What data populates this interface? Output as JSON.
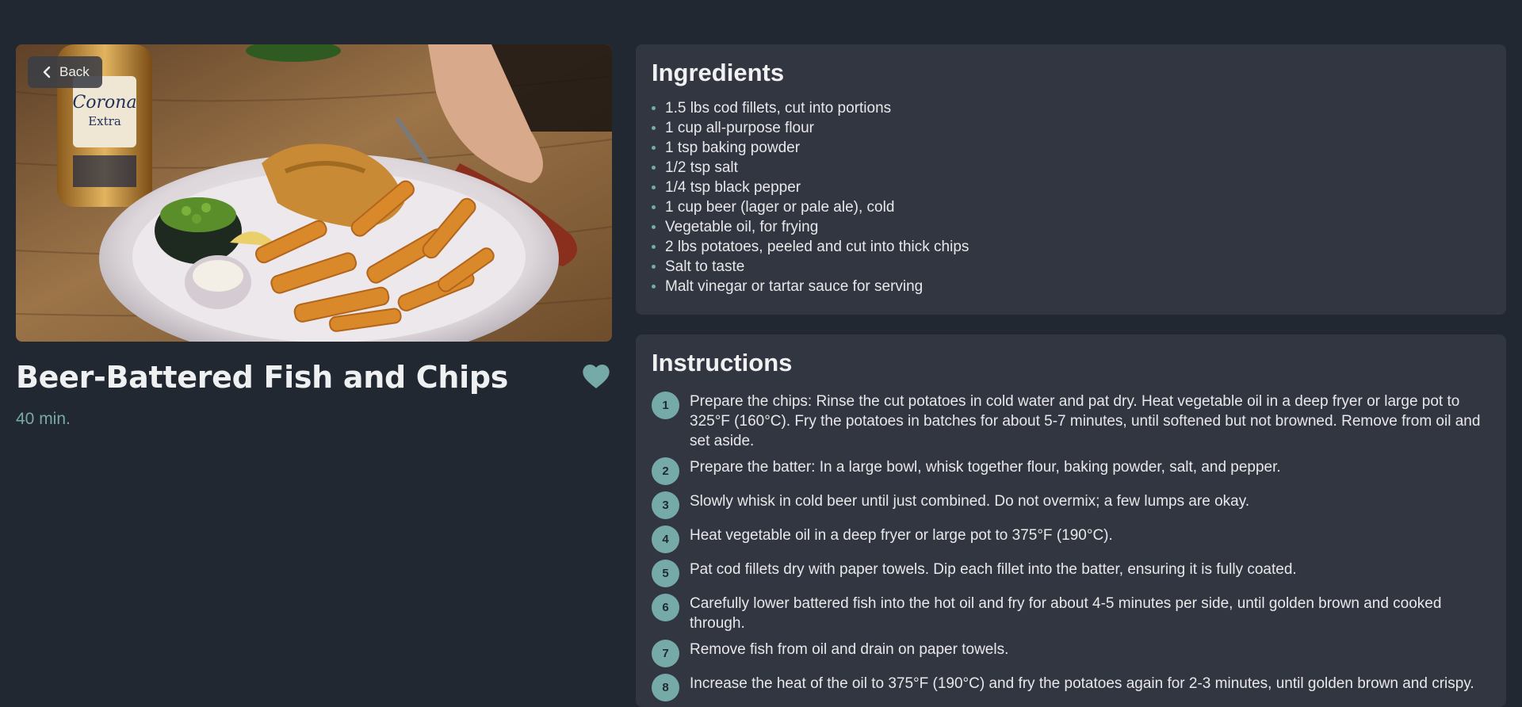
{
  "nav": {
    "back_label": "Back",
    "back_icon": "chevron-left-icon"
  },
  "recipe": {
    "title": "Beer-Battered Fish and Chips",
    "time": "40 min.",
    "favorite_icon": "heart-icon",
    "accent_color": "#76aaa9"
  },
  "ingredients": {
    "heading": "Ingredients",
    "items": [
      "1.5 lbs cod fillets, cut into portions",
      "1 cup all-purpose flour",
      "1 tsp baking powder",
      "1/2 tsp salt",
      "1/4 tsp black pepper",
      "1 cup beer (lager or pale ale), cold",
      "Vegetable oil, for frying",
      "2 lbs potatoes, peeled and cut into thick chips",
      "Salt to taste",
      "Malt vinegar or tartar sauce for serving"
    ]
  },
  "instructions": {
    "heading": "Instructions",
    "steps": [
      {
        "number": "1",
        "text": "Prepare the chips: Rinse the cut potatoes in cold water and pat dry. Heat vegetable oil in a deep fryer or large pot to 325°F (160°C). Fry the potatoes in batches for about 5-7 minutes, until softened but not browned. Remove from oil and set aside."
      },
      {
        "number": "2",
        "text": "Prepare the batter: In a large bowl, whisk together flour, baking powder, salt, and pepper."
      },
      {
        "number": "3",
        "text": "Slowly whisk in cold beer until just combined. Do not overmix; a few lumps are okay."
      },
      {
        "number": "4",
        "text": "Heat vegetable oil in a deep fryer or large pot to 375°F (190°C)."
      },
      {
        "number": "5",
        "text": "Pat cod fillets dry with paper towels. Dip each fillet into the batter, ensuring it is fully coated."
      },
      {
        "number": "6",
        "text": "Carefully lower battered fish into the hot oil and fry for about 4-5 minutes per side, until golden brown and cooked through."
      },
      {
        "number": "7",
        "text": "Remove fish from oil and drain on paper towels."
      },
      {
        "number": "8",
        "text": "Increase the heat of the oil to 375°F (190°C) and fry the potatoes again for 2-3 minutes, until golden brown and crispy."
      }
    ]
  }
}
